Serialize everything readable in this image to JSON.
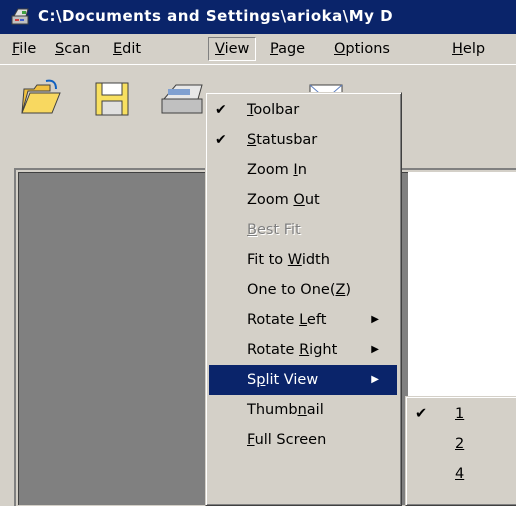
{
  "window": {
    "title": "C:\\Documents and Settings\\arioka\\My D"
  },
  "menubar": {
    "items": [
      {
        "pre": "",
        "key": "F",
        "post": "ile"
      },
      {
        "pre": "",
        "key": "S",
        "post": "can"
      },
      {
        "pre": "",
        "key": "E",
        "post": "dit"
      },
      {
        "pre": "",
        "key": "V",
        "post": "iew"
      },
      {
        "pre": "",
        "key": "P",
        "post": "age"
      },
      {
        "pre": "",
        "key": "O",
        "post": "ptions"
      },
      {
        "pre": "",
        "key": "H",
        "post": "elp"
      }
    ]
  },
  "toolbar": {
    "buttons": [
      "open-folder-icon",
      "save-disk-icon",
      "scanner-icon",
      "send-mail-icon"
    ]
  },
  "view_menu": {
    "items": [
      {
        "checked": true,
        "pre": "",
        "key": "T",
        "post": "oolbar"
      },
      {
        "checked": true,
        "pre": "",
        "key": "S",
        "post": "tatusbar"
      },
      {
        "checked": false,
        "pre": "Zoom ",
        "key": "I",
        "post": "n"
      },
      {
        "checked": false,
        "pre": "Zoom ",
        "key": "O",
        "post": "ut"
      },
      {
        "checked": false,
        "disabled": true,
        "pre": "",
        "key": "B",
        "post": "est Fit"
      },
      {
        "checked": false,
        "pre": "Fit to ",
        "key": "W",
        "post": "idth"
      },
      {
        "checked": false,
        "pre": "One to One(",
        "key": "Z",
        "post": ")"
      },
      {
        "checked": false,
        "submenu": true,
        "pre": "Rotate ",
        "key": "L",
        "post": "eft"
      },
      {
        "checked": false,
        "submenu": true,
        "pre": "Rotate ",
        "key": "R",
        "post": "ight"
      },
      {
        "checked": false,
        "submenu": true,
        "highlighted": true,
        "pre": "S",
        "key": "p",
        "post": "lit View"
      },
      {
        "checked": false,
        "pre": "Thumb",
        "key": "n",
        "post": "ail"
      },
      {
        "checked": false,
        "pre": "",
        "key": "F",
        "post": "ull Screen"
      }
    ]
  },
  "split_view_submenu": {
    "items": [
      {
        "checked": true,
        "label": "1"
      },
      {
        "checked": false,
        "label": "2"
      },
      {
        "checked": false,
        "label": "4"
      }
    ]
  },
  "glyphs": {
    "check": "✔",
    "submenu_arrow": "▶"
  }
}
